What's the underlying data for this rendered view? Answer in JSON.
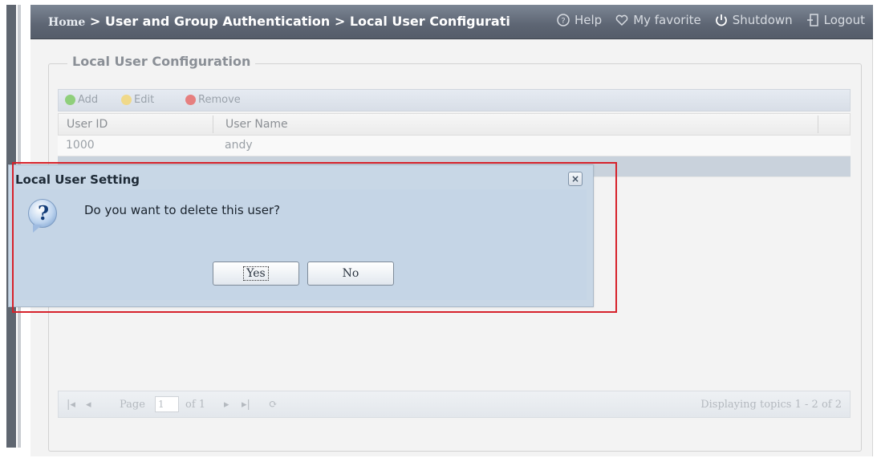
{
  "header": {
    "breadcrumb": {
      "home": "Home",
      "sep1": " > ",
      "section": "User and Group Authentication",
      "sep2": " > ",
      "page": "Local User Configurati"
    },
    "links": {
      "help": "Help",
      "favorite": "My favorite",
      "shutdown": "Shutdown",
      "logout": "Logout"
    }
  },
  "panel": {
    "legend": "Local User Configuration",
    "toolbar": {
      "add": "Add",
      "edit": "Edit",
      "remove": "Remove"
    },
    "columns": [
      "User ID",
      "User Name"
    ],
    "rows": [
      {
        "id": "1000",
        "name": "andy"
      },
      {
        "id": "",
        "name": ""
      }
    ],
    "pager": {
      "page_label": "Page",
      "page_value": "1",
      "of_label": "of 1",
      "displaying": "Displaying topics 1 - 2 of 2"
    }
  },
  "dialog": {
    "title": "Local User Setting",
    "close": "×",
    "message": "Do you want to delete this user?",
    "yes": "Yes",
    "no": "No",
    "icon": "question-icon"
  },
  "colors": {
    "highlight": "#d6222b",
    "dialog_bg": "#c8d7e6",
    "topbar": "#5d6573"
  }
}
